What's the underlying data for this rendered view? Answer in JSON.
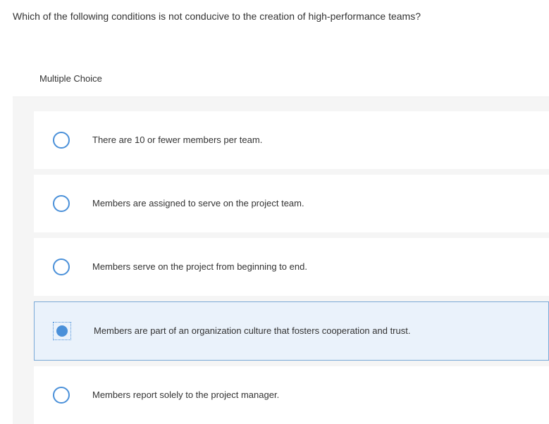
{
  "question": "Which of the following conditions is not conducive to the creation of high-performance teams?",
  "section_label": "Multiple Choice",
  "options": [
    {
      "label": "There are 10 or fewer members per team.",
      "selected": false
    },
    {
      "label": "Members are assigned to serve on the project team.",
      "selected": false
    },
    {
      "label": "Members serve on the project from beginning to end.",
      "selected": false
    },
    {
      "label": "Members are part of an organization culture that fosters cooperation and trust.",
      "selected": true
    },
    {
      "label": "Members report solely to the project manager.",
      "selected": false
    }
  ]
}
